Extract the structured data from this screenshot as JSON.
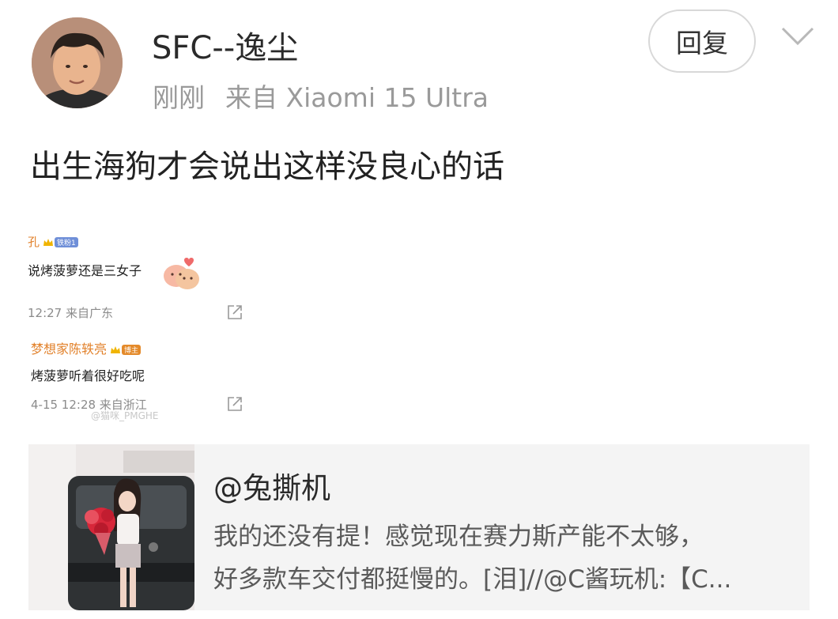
{
  "post": {
    "username": "SFC--逸尘",
    "time": "刚刚",
    "source": "来自 Xiaomi 15 Ultra",
    "reply_label": "回复",
    "content": "出生海狗才会说出这样没良心的话"
  },
  "embedded_image": {
    "comment1": {
      "name": "孔",
      "badge": "铁粉1",
      "text": "说烤菠萝还是三女子",
      "time": "12:27 来自广东"
    },
    "comment2": {
      "name": "梦想家陈轶亮",
      "badge": "博主",
      "text": "烤菠萝听着很好吃呢",
      "time": "4-15 12:28 来自浙江"
    },
    "watermark": "@猫咪_PMGHE"
  },
  "repost": {
    "user": "@兔撕机",
    "line1": "我的还没有提！感觉现在赛力斯产能不太够，",
    "line2": "好多款车交付都挺慢的。[泪]//@C酱玩机:【C..."
  },
  "icons": {
    "chevron": "chevron-down-icon",
    "share": "share-icon"
  },
  "colors": {
    "background": "#ffffff",
    "repost_background": "#f4f4f4",
    "meta_text": "#9a9a9a",
    "comment_name": "#e2822c"
  }
}
